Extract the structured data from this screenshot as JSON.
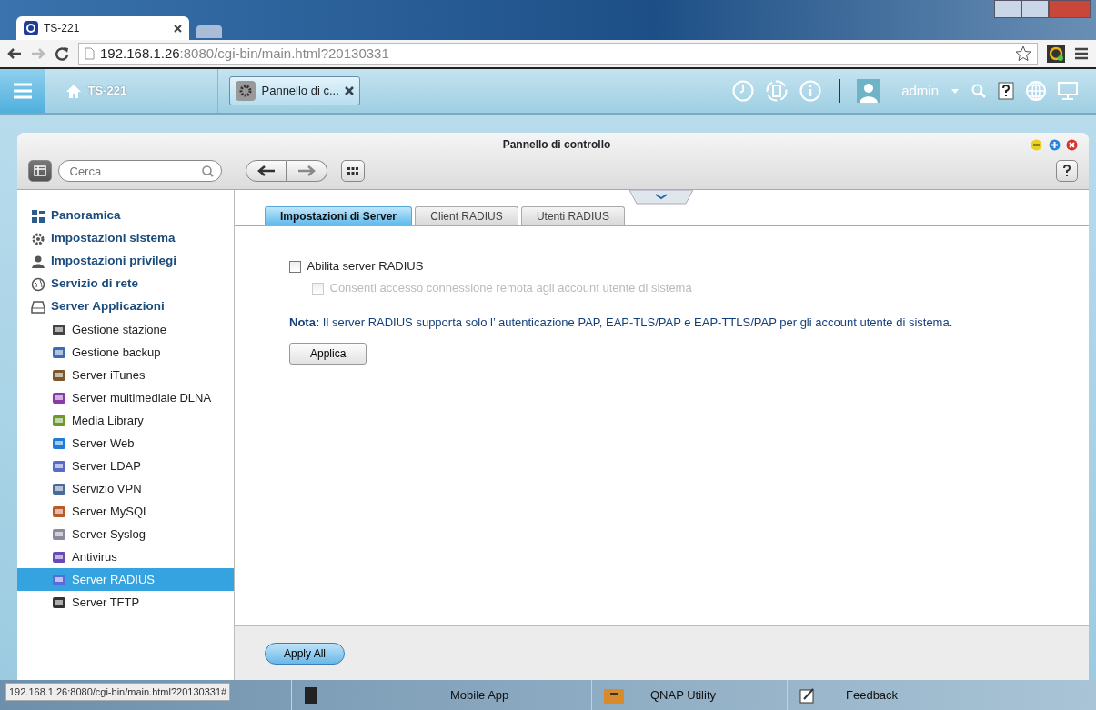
{
  "browser": {
    "tab_title": "TS-221",
    "address_host": "192.168.1.26",
    "address_rest": ":8080/cgi-bin/main.html?20130331"
  },
  "topbar": {
    "home_label": "TS-221",
    "open_app": "Pannello di c...",
    "user": "admin"
  },
  "window": {
    "title": "Pannello di controllo",
    "search_placeholder": "Cerca"
  },
  "sidebar": {
    "items": [
      {
        "label": "Panoramica",
        "selected": false
      },
      {
        "label": "Impostazioni sistema",
        "selected": false
      },
      {
        "label": "Impostazioni privilegi",
        "selected": false
      },
      {
        "label": "Servizio di rete",
        "selected": false
      },
      {
        "label": "Server Applicazioni",
        "selected": false,
        "children": [
          {
            "label": "Gestione stazione",
            "selected": false
          },
          {
            "label": "Gestione backup",
            "selected": false
          },
          {
            "label": "Server iTunes",
            "selected": false
          },
          {
            "label": "Server multimediale DLNA",
            "selected": false
          },
          {
            "label": "Media Library",
            "selected": false
          },
          {
            "label": "Server Web",
            "selected": false
          },
          {
            "label": "Server LDAP",
            "selected": false
          },
          {
            "label": "Servizio VPN",
            "selected": false
          },
          {
            "label": "Server MySQL",
            "selected": false
          },
          {
            "label": "Server Syslog",
            "selected": false
          },
          {
            "label": "Antivirus",
            "selected": false
          },
          {
            "label": "Server RADIUS",
            "selected": true
          },
          {
            "label": "Server TFTP",
            "selected": false
          }
        ]
      }
    ]
  },
  "tabs": [
    {
      "label": "Impostazioni di Server",
      "selected": true
    },
    {
      "label": "Client RADIUS",
      "selected": false
    },
    {
      "label": "Utenti RADIUS",
      "selected": false
    }
  ],
  "settings": [
    {
      "label": "Abilita server RADIUS",
      "checked": false,
      "disabled": false,
      "children": [
        {
          "label": "Consenti accesso connessione remota agli account utente di sistema",
          "checked": false,
          "disabled": true
        }
      ]
    }
  ],
  "note": "**Nota:** Il server RADIUS supporta solo l’  autenticazione PAP, EAP-TLS/PAP e EAP-TTLS/PAP per gli account utente di sistema.",
  "apply_button": "Applica",
  "apply_all_button": "Apply All",
  "taskbar": {
    "items": [
      "Mobile App",
      "QNAP Utility",
      "Feedback"
    ]
  },
  "status_url": "192.168.1.26:8080/cgi-bin/main.html?20130331#"
}
